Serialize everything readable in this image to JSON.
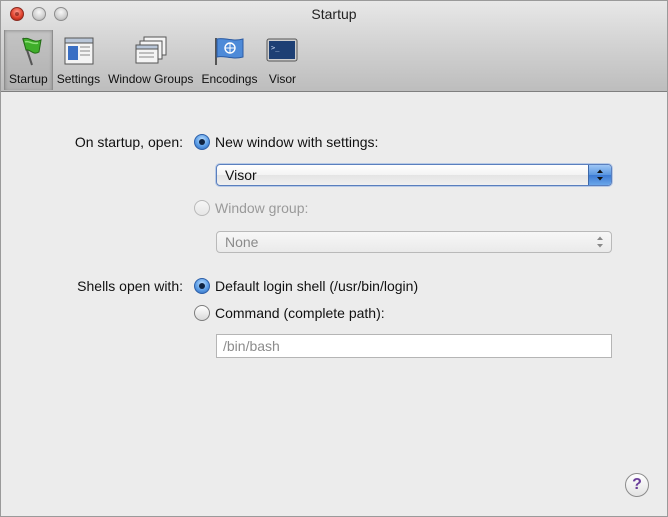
{
  "window": {
    "title": "Startup"
  },
  "toolbar": {
    "items": [
      {
        "label": "Startup",
        "icon": "green-flag-icon",
        "selected": true
      },
      {
        "label": "Settings",
        "icon": "settings-window-icon",
        "selected": false
      },
      {
        "label": "Window Groups",
        "icon": "window-groups-icon",
        "selected": false
      },
      {
        "label": "Encodings",
        "icon": "un-flag-icon",
        "selected": false
      },
      {
        "label": "Visor",
        "icon": "terminal-screen-icon",
        "selected": false
      }
    ]
  },
  "startup": {
    "label": "On startup, open:",
    "new_window_option": "New window with settings:",
    "settings_popup_value": "Visor",
    "window_group_option": "Window group:",
    "window_group_popup_value": "None"
  },
  "shells": {
    "label": "Shells open with:",
    "default_option": "Default login shell (/usr/bin/login)",
    "command_option": "Command (complete path):",
    "command_placeholder": "/bin/bash"
  },
  "help": {
    "symbol": "?"
  },
  "colors": {
    "accent": "#3c7ad3",
    "help_glyph": "#6a3d9a",
    "close_button": "#e0442f"
  }
}
